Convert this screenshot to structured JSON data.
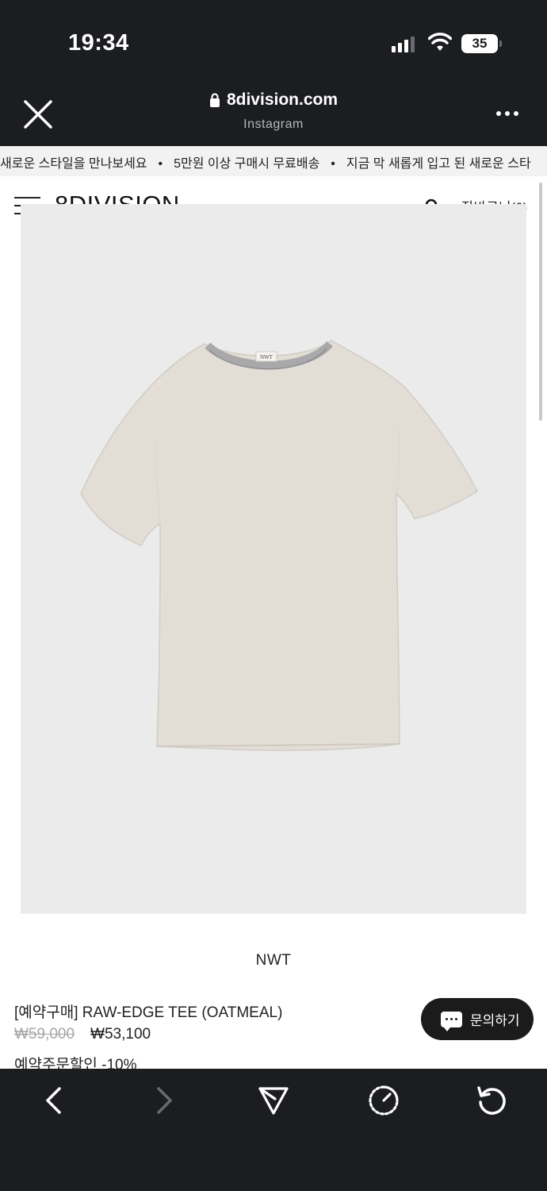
{
  "status": {
    "time": "19:34",
    "battery": "35"
  },
  "browser": {
    "domain": "8division.com",
    "source": "Instagram"
  },
  "ticker": {
    "items": [
      "새로운 스타일을 만나보세요",
      "5만원 이상 구매시 무료배송",
      "지금 막 새롭게 입고 된 새로운 스타"
    ]
  },
  "header": {
    "logo": "8DIVISION",
    "cart_label": "장바구니(0)"
  },
  "product": {
    "brand": "NWT",
    "title": "[예약구매] RAW-EDGE TEE (OATMEAL)",
    "price_original": "₩59,000",
    "price_sale": "₩53,100",
    "discount_note": "예약주문할인 -10%",
    "neck_label": "NWT",
    "image_bg": "#ebebeb",
    "shirt_color": "#e6e1d9",
    "collar_color": "#a9a9ab"
  },
  "inquiry": {
    "label": "문의하기"
  }
}
